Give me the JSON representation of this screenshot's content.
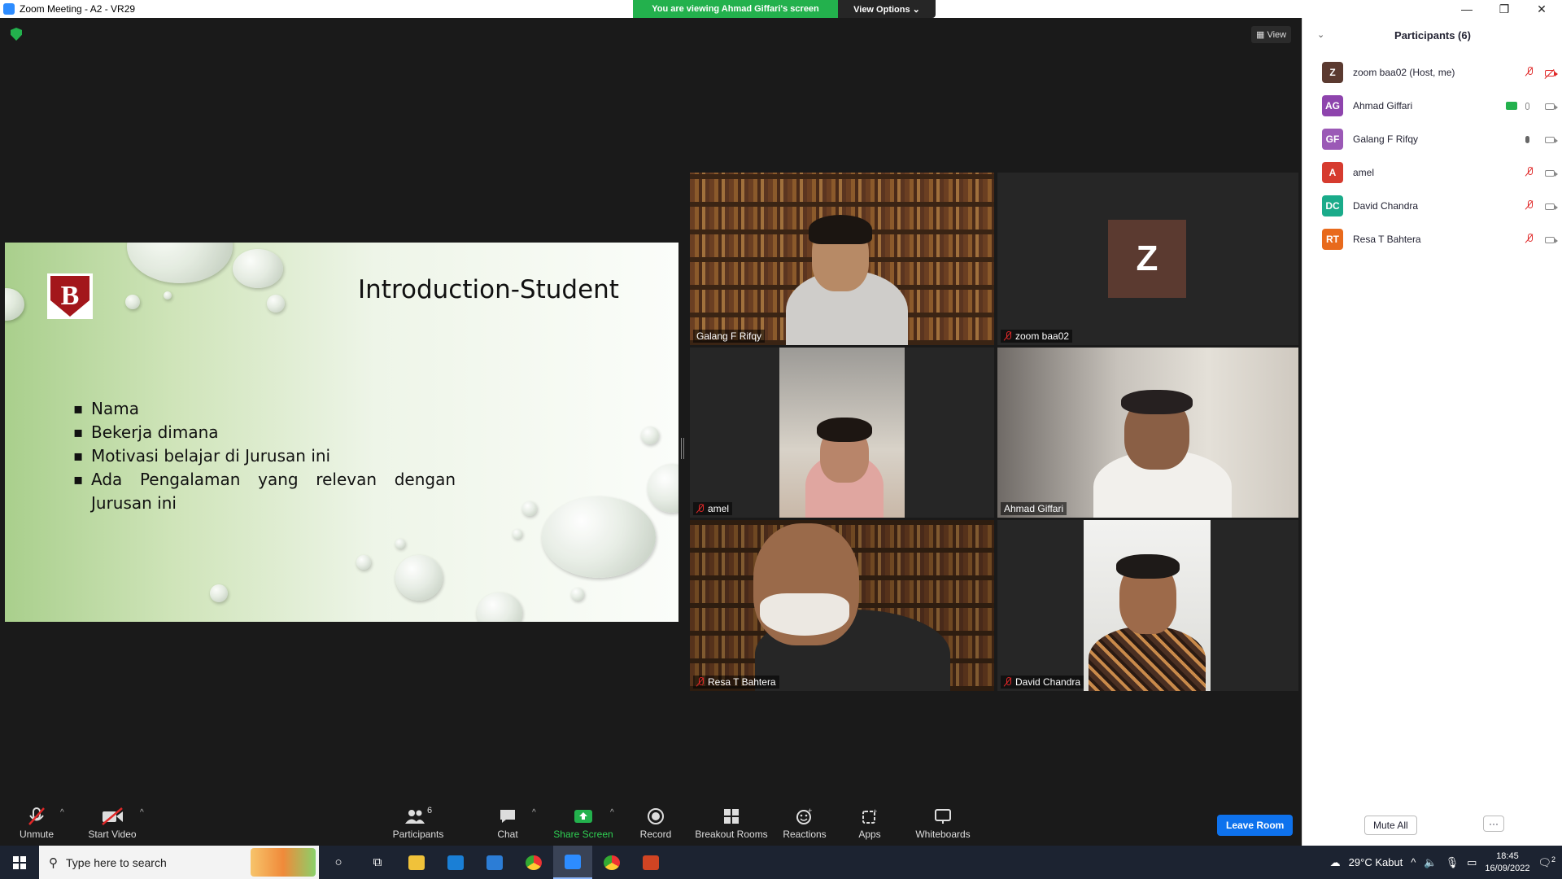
{
  "window": {
    "title": "Zoom Meeting - A2 - VR29"
  },
  "banner": {
    "viewing": "You are viewing Ahmad Giffari's screen",
    "view_options": "View Options ⌄"
  },
  "view_button": "View",
  "slide": {
    "title": "Introduction-Student",
    "bullets": [
      "Nama",
      "Bekerja dimana",
      "Motivasi belajar di Jurusan ini",
      "Ada Pengalaman yang relevan dengan Jurusan ini"
    ],
    "logo_letter": "B"
  },
  "tiles": [
    {
      "name": "Galang F Rifqy",
      "muted": false,
      "active": true
    },
    {
      "name": "zoom baa02",
      "muted": true,
      "avatar": "Z"
    },
    {
      "name": "amel",
      "muted": true
    },
    {
      "name": "Ahmad Giffari",
      "muted": false
    },
    {
      "name": "Resa T Bahtera",
      "muted": true
    },
    {
      "name": "David Chandra",
      "muted": true
    }
  ],
  "toolbar": {
    "unmute": "Unmute",
    "start_video": "Start Video",
    "participants": "Participants",
    "participants_count": "6",
    "chat": "Chat",
    "share_screen": "Share Screen",
    "record": "Record",
    "breakout": "Breakout Rooms",
    "reactions": "Reactions",
    "apps": "Apps",
    "whiteboards": "Whiteboards",
    "leave": "Leave Room"
  },
  "panel": {
    "title": "Participants (6)",
    "participants": [
      {
        "initials": "Z",
        "name": "zoom baa02 (Host, me)",
        "color": "#5b3a30"
      },
      {
        "initials": "AG",
        "name": "Ahmad Giffari",
        "color": "#8e44ad"
      },
      {
        "initials": "GF",
        "name": "Galang F Rifqy",
        "color": "#9b59b6"
      },
      {
        "initials": "A",
        "name": "amel",
        "color": "#d63b2f"
      },
      {
        "initials": "DC",
        "name": "David Chandra",
        "color": "#1aab8a"
      },
      {
        "initials": "RT",
        "name": "Resa T Bahtera",
        "color": "#e86a1c"
      }
    ],
    "mute_all": "Mute All",
    "more": "···"
  },
  "taskbar": {
    "search_placeholder": "Type here to search",
    "weather": "29°C  Kabut",
    "time": "18:45",
    "date": "16/09/2022",
    "notif_count": "2"
  }
}
